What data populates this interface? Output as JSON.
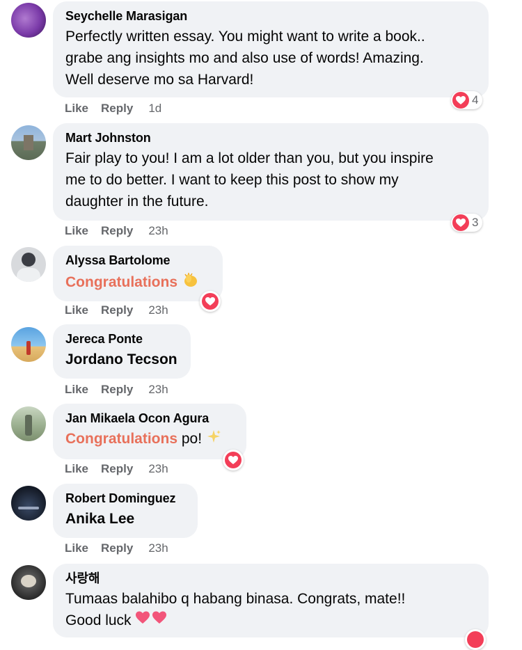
{
  "actions": {
    "like": "Like",
    "reply": "Reply"
  },
  "comments": [
    {
      "author": "Seychelle Marasigan",
      "lines": [
        "Perfectly written essay. You might want to write a book..",
        "grabe ang insights mo and also use of words! Amazing.",
        "Well deserve mo sa Harvard!"
      ],
      "time": "1d",
      "reaction_count": "4",
      "avatar_icon": "profile-photo-purple"
    },
    {
      "author": "Mart Johnston",
      "lines": [
        "Fair play to you! I am a lot older than you, but you inspire",
        "me to do better. I want to keep this post to show my",
        "daughter in the future."
      ],
      "time": "23h",
      "reaction_count": "3",
      "avatar_icon": "profile-photo-building"
    },
    {
      "author": "Alyssa Bartolome",
      "accent_text": "Congratulations",
      "emoji": "clapping-hands-emoji",
      "time": "23h",
      "avatar_icon": "profile-photo-person"
    },
    {
      "author": "Jereca Ponte",
      "text": "Jordano Tecson",
      "time": "23h",
      "avatar_icon": "profile-photo-beach"
    },
    {
      "author": "Jan Mikaela Ocon Agura",
      "accent_text": "Congratulations",
      "suffix": " po!",
      "emoji": "sparkles-emoji",
      "time": "23h",
      "avatar_icon": "profile-photo-trees"
    },
    {
      "author": "Robert Dominguez",
      "text": "Anika Lee",
      "time": "23h",
      "avatar_icon": "profile-photo-dark"
    },
    {
      "author": "사랑해",
      "lines": [
        "Tumaas balahibo q habang binasa. Congrats, mate!!",
        "Good luck"
      ],
      "emoji": "sparkling-heart-emoji",
      "avatar_icon": "profile-photo-cat"
    }
  ],
  "colors": {
    "bubble": "#f0f2f5",
    "accent": "#e8705a",
    "heart": "#f33e58",
    "muted": "#65676b"
  }
}
